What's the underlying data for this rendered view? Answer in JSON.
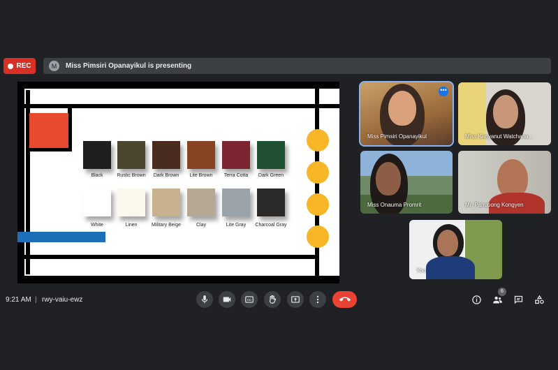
{
  "recording": {
    "label": "REC"
  },
  "presenting": {
    "avatar_letter": "M",
    "text": "Miss Pimsiri Opanayikul is presenting"
  },
  "slide": {
    "swatches_row1": [
      {
        "label": "Black",
        "color": "#1e1e1e"
      },
      {
        "label": "Rustic Brown",
        "color": "#4b4630"
      },
      {
        "label": "Dark Brown",
        "color": "#4a2b20"
      },
      {
        "label": "Lite Brown",
        "color": "#874324"
      },
      {
        "label": "Terra Cotta",
        "color": "#7c2531"
      },
      {
        "label": "Dark Green",
        "color": "#1f5031"
      }
    ],
    "swatches_row2": [
      {
        "label": "White",
        "color": "#ffffff"
      },
      {
        "label": "Linen",
        "color": "#fbf8ee"
      },
      {
        "label": "Military Beige",
        "color": "#c9b08e"
      },
      {
        "label": "Clay",
        "color": "#b7a894"
      },
      {
        "label": "Lite Gray",
        "color": "#9aa2aa"
      },
      {
        "label": "Charcoal Gray",
        "color": "#2b2a28"
      }
    ]
  },
  "participants": [
    {
      "name": "Miss Pimsiri Opanayikul"
    },
    {
      "name": "Miss Kanyanut Watchana..."
    },
    {
      "name": "Miss Onauma Promrit"
    },
    {
      "name": "Mr. Panupong Kongyen"
    },
    {
      "name": "You"
    }
  ],
  "meeting": {
    "time": "9:21 AM",
    "code": "rwy-vaiu-ewz",
    "participant_count": "6"
  },
  "controls": [
    "microphone-icon",
    "camera-icon",
    "captions-icon",
    "raise-hand-icon",
    "present-icon",
    "more-options-icon",
    "end-call-icon"
  ],
  "right_controls": [
    "info-icon",
    "people-icon",
    "chat-icon",
    "activities-icon"
  ]
}
